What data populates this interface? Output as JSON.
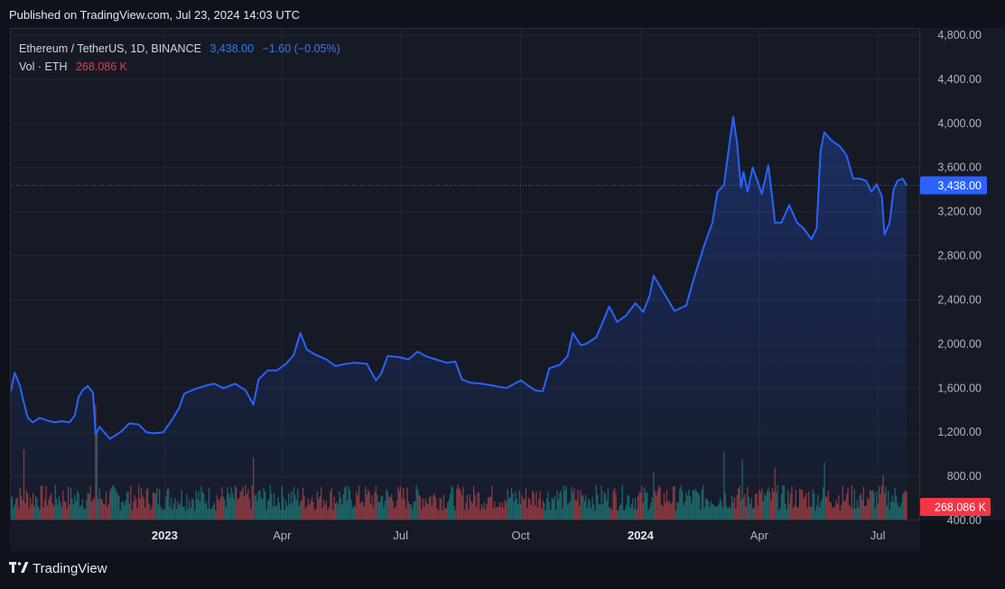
{
  "header": {
    "published": "Published on TradingView.com, Jul 23, 2024 14:03 UTC"
  },
  "legend": {
    "symbol": "Ethereum / TetherUS, 1D, BINANCE",
    "price": "3,438.00",
    "change": "−1.60 (−0.05%)",
    "vol_label": "Vol · ETH",
    "vol_value": "268.086 K"
  },
  "footer": {
    "brand": "TradingView"
  },
  "colors": {
    "line": "#2962ff",
    "up": "#26a69a",
    "down": "#ef5350",
    "label_price": "#2962ff",
    "label_vol": "#f23645"
  },
  "chart_data": {
    "type": "area",
    "title": "Ethereum / TetherUS, 1D, BINANCE",
    "ylim": [
      1000,
      4900
    ],
    "y_ticks": [
      "4,800.00",
      "4,400.00",
      "4,000.00",
      "3,600.00",
      "3,200.00",
      "2,800.00",
      "2,400.00",
      "2,000.00",
      "1,600.00",
      "1,200.00",
      "800.00",
      "400.00"
    ],
    "x_ticks": [
      {
        "label": "2023",
        "date": "2023-01-01",
        "bold": true
      },
      {
        "label": "Apr",
        "date": "2023-04-01",
        "bold": false
      },
      {
        "label": "Jul",
        "date": "2023-07-01",
        "bold": false
      },
      {
        "label": "Oct",
        "date": "2023-10-01",
        "bold": false
      },
      {
        "label": "2024",
        "date": "2024-01-01",
        "bold": true
      },
      {
        "label": "Apr",
        "date": "2024-04-01",
        "bold": false
      },
      {
        "label": "Jul",
        "date": "2024-07-01",
        "bold": false
      }
    ],
    "last_price": 3438.0,
    "last_price_label": "3,438.00",
    "last_volume_label": "268.086 K",
    "grid": true,
    "series": [
      {
        "x": [
          "2022-09-05",
          "2022-09-08",
          "2022-09-12",
          "2022-09-15",
          "2022-09-18",
          "2022-09-22",
          "2022-09-27",
          "2022-10-02",
          "2022-10-08",
          "2022-10-14",
          "2022-10-20",
          "2022-10-24",
          "2022-10-27",
          "2022-10-30",
          "2022-11-03",
          "2022-11-07",
          "2022-11-09",
          "2022-11-12",
          "2022-11-20",
          "2022-11-28",
          "2022-12-05",
          "2022-12-12",
          "2022-12-18",
          "2022-12-24",
          "2022-12-31",
          "2023-01-07",
          "2023-01-12",
          "2023-01-16",
          "2023-01-24",
          "2023-02-01",
          "2023-02-08",
          "2023-02-15",
          "2023-02-24",
          "2023-03-04",
          "2023-03-10",
          "2023-03-14",
          "2023-03-21",
          "2023-03-28",
          "2023-04-04",
          "2023-04-10",
          "2023-04-15",
          "2023-04-20",
          "2023-04-27",
          "2023-05-05",
          "2023-05-12",
          "2023-05-20",
          "2023-05-27",
          "2023-06-05",
          "2023-06-12",
          "2023-06-16",
          "2023-06-21",
          "2023-06-30",
          "2023-07-07",
          "2023-07-14",
          "2023-07-20",
          "2023-07-28",
          "2023-08-05",
          "2023-08-12",
          "2023-08-17",
          "2023-08-23",
          "2023-09-01",
          "2023-09-11",
          "2023-09-20",
          "2023-10-01",
          "2023-10-12",
          "2023-10-18",
          "2023-10-23",
          "2023-10-31",
          "2023-11-06",
          "2023-11-10",
          "2023-11-16",
          "2023-11-20",
          "2023-11-28",
          "2023-12-08",
          "2023-12-14",
          "2023-12-21",
          "2023-12-28",
          "2024-01-03",
          "2024-01-08",
          "2024-01-11",
          "2024-01-15",
          "2024-01-22",
          "2024-01-27",
          "2024-02-05",
          "2024-02-12",
          "2024-02-19",
          "2024-02-25",
          "2024-02-29",
          "2024-03-05",
          "2024-03-09",
          "2024-03-12",
          "2024-03-15",
          "2024-03-18",
          "2024-03-20",
          "2024-03-23",
          "2024-03-27",
          "2024-03-30",
          "2024-04-03",
          "2024-04-08",
          "2024-04-12",
          "2024-04-13",
          "2024-04-18",
          "2024-04-24",
          "2024-04-30",
          "2024-05-05",
          "2024-05-11",
          "2024-05-15",
          "2024-05-18",
          "2024-05-21",
          "2024-05-26",
          "2024-06-02",
          "2024-06-07",
          "2024-06-12",
          "2024-06-17",
          "2024-06-22",
          "2024-06-26",
          "2024-06-30",
          "2024-07-04",
          "2024-07-06",
          "2024-07-10",
          "2024-07-13",
          "2024-07-16",
          "2024-07-20",
          "2024-07-23"
        ],
        "values": [
          1570,
          1740,
          1620,
          1470,
          1330,
          1290,
          1330,
          1310,
          1290,
          1300,
          1290,
          1350,
          1520,
          1580,
          1620,
          1560,
          1180,
          1250,
          1140,
          1200,
          1280,
          1270,
          1200,
          1190,
          1200,
          1320,
          1420,
          1550,
          1590,
          1620,
          1640,
          1600,
          1640,
          1580,
          1450,
          1680,
          1760,
          1760,
          1820,
          1900,
          2100,
          1950,
          1900,
          1860,
          1800,
          1820,
          1830,
          1820,
          1670,
          1730,
          1890,
          1880,
          1860,
          1930,
          1890,
          1860,
          1830,
          1840,
          1680,
          1650,
          1640,
          1620,
          1600,
          1670,
          1580,
          1570,
          1780,
          1810,
          1890,
          2100,
          1990,
          2000,
          2060,
          2340,
          2200,
          2260,
          2370,
          2290,
          2440,
          2620,
          2540,
          2400,
          2300,
          2350,
          2640,
          2900,
          3100,
          3380,
          3440,
          3800,
          4060,
          3820,
          3420,
          3560,
          3380,
          3600,
          3500,
          3360,
          3620,
          3220,
          3100,
          3100,
          3260,
          3100,
          3050,
          2950,
          3050,
          3750,
          3920,
          3850,
          3790,
          3710,
          3500,
          3500,
          3480,
          3380,
          3450,
          3340,
          2990,
          3100,
          3400,
          3480,
          3500,
          3438
        ]
      }
    ],
    "volume": {
      "note": "daily volume bars (ETH), colored by up/down day",
      "ylim": [
        0,
        1600
      ],
      "spikes": [
        {
          "date": "2022-09-15",
          "value": 700
        },
        {
          "date": "2022-11-09",
          "value": 1150
        },
        {
          "date": "2022-11-10",
          "value": 900
        },
        {
          "date": "2023-03-10",
          "value": 620
        },
        {
          "date": "2024-01-11",
          "value": 480
        },
        {
          "date": "2024-03-05",
          "value": 680
        },
        {
          "date": "2024-03-19",
          "value": 600
        },
        {
          "date": "2024-04-13",
          "value": 520
        },
        {
          "date": "2024-05-21",
          "value": 570
        },
        {
          "date": "2024-07-05",
          "value": 450
        }
      ]
    }
  }
}
